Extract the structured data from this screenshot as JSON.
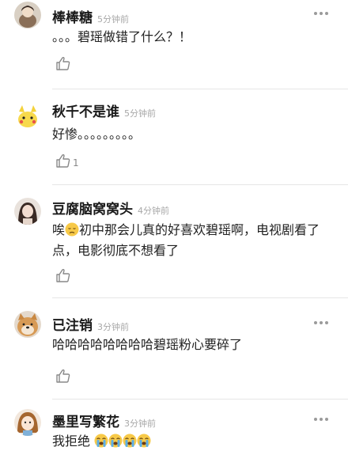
{
  "comments": [
    {
      "name": "棒棒糖",
      "time": "5分钟前",
      "text": "。。。碧瑶做错了什么？！",
      "likes": ""
    },
    {
      "name": "秋千不是谁",
      "time": "5分钟前",
      "text": "好惨。。。。。。。。。",
      "likes": "1"
    },
    {
      "name": "豆腐脑窝窝头",
      "time": "4分钟前",
      "text_before_emoji": "唉",
      "text_after_emoji": "初中那会儿真的好喜欢碧瑶啊，电视剧看了点，电影彻底不想看了",
      "likes": ""
    },
    {
      "name": "已注销",
      "time": "3分钟前",
      "text": "哈哈哈哈哈哈哈哈碧瑶粉心要碎了",
      "likes": ""
    },
    {
      "name": "墨里写繁花",
      "time": "3分钟前",
      "text": "我拒绝",
      "likes": ""
    }
  ],
  "icons": {
    "more": "more-dots-icon",
    "like": "thumbs-up-icon",
    "sad_emoji": "disappointed-face-emoji",
    "crying_emoji": "loudly-crying-face-emoji"
  },
  "colors": {
    "name": "#1a1a1a",
    "time": "#a8a8a8",
    "text": "#222222",
    "divider": "#e6e6e6"
  }
}
